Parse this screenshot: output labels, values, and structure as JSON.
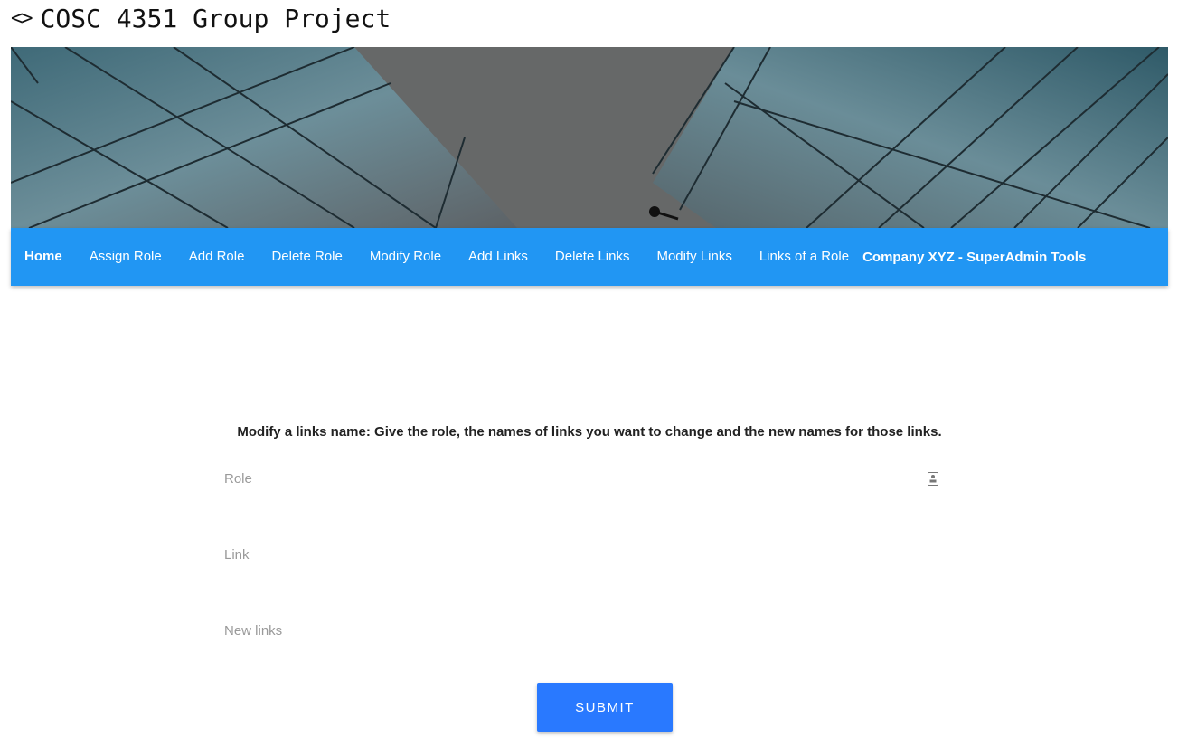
{
  "header": {
    "icon": "code-brackets-icon",
    "icon_glyph": "<>",
    "title": "COSC 4351 Group Project"
  },
  "hero": {
    "image": "glass-skyscrapers-photo"
  },
  "nav": {
    "items": [
      {
        "label": "Home",
        "active": true
      },
      {
        "label": "Assign Role"
      },
      {
        "label": "Add Role"
      },
      {
        "label": "Delete Role"
      },
      {
        "label": "Modify Role"
      },
      {
        "label": "Add Links"
      },
      {
        "label": "Delete Links"
      },
      {
        "label": "Modify Links"
      },
      {
        "label": "Links of a Role"
      }
    ],
    "brand": "Company XYZ - SuperAdmin Tools",
    "color": "#2196f3"
  },
  "form": {
    "instructions": "Modify a links name: Give the role, the names of links you want to change and the new names for those links.",
    "fields": {
      "role": {
        "placeholder": "Role",
        "value": "",
        "icon": "contact-card-icon"
      },
      "link": {
        "placeholder": "Link",
        "value": ""
      },
      "new_links": {
        "placeholder": "New links",
        "value": ""
      }
    },
    "submit_label": "SUBMIT",
    "submit_color": "#2979ff"
  }
}
